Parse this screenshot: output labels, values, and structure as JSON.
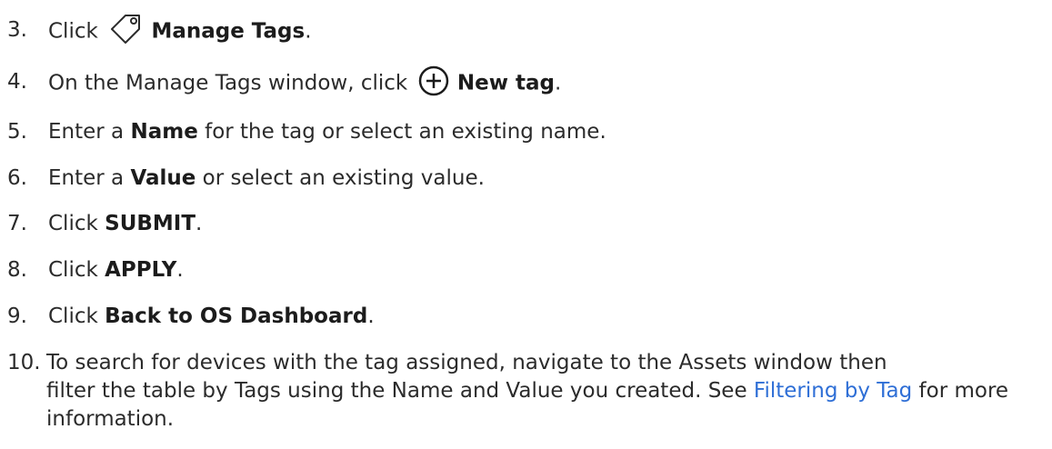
{
  "steps": [
    {
      "num": "3.",
      "pre": "Click",
      "bold": "Manage Tags",
      "post": ".",
      "icon": "tag-icon"
    },
    {
      "num": "4.",
      "pre": "On the Manage Tags window, click",
      "bold": "New tag",
      "post": ".",
      "icon": "plus-circle-icon"
    },
    {
      "num": "5.",
      "pre": "Enter a ",
      "bold": "Name",
      "post": " for the tag or select an existing name."
    },
    {
      "num": "6.",
      "pre": "Enter a ",
      "bold": "Value",
      "post": " or select an existing value."
    },
    {
      "num": "7.",
      "pre": "Click ",
      "bold": "SUBMIT",
      "post": "."
    },
    {
      "num": "8.",
      "pre": "Click ",
      "bold": "APPLY",
      "post": "."
    },
    {
      "num": "9.",
      "pre": "Click ",
      "bold": "Back to OS Dashboard",
      "post": "."
    },
    {
      "num": "10.",
      "line1": "To search for devices with the tag assigned, navigate to the Assets window then",
      "line2_pre": "filter the table by Tags using the Name and Value you created. See ",
      "link": "Filtering by Tag",
      "line3_post": " for more information."
    }
  ],
  "colors": {
    "text": "#2b2b2b",
    "link": "#2f6fd6"
  }
}
